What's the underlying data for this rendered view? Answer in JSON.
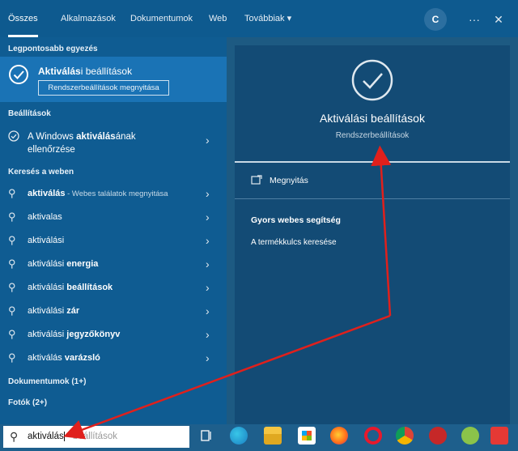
{
  "tabs": [
    {
      "label": "Összes"
    },
    {
      "label": "Alkalmazások"
    },
    {
      "label": "Dokumentumok"
    },
    {
      "label": "Web"
    },
    {
      "label": "Továbbiak ▾"
    }
  ],
  "header": {
    "avatar_letter": "C",
    "more": "···",
    "close": "✕"
  },
  "best_match": {
    "section": "Legpontosabb egyezés",
    "title_bold": "Aktiválás",
    "title_rest": "i beállítások",
    "action": "Rendszerbeállítások megnyitása"
  },
  "settings": {
    "section": "Beállítások",
    "line1_pre": "A Windows ",
    "line1_bold": "aktiválás",
    "line1_post": "ának",
    "line2": "ellenőrzése"
  },
  "web": {
    "section": "Keresés a weben",
    "items": [
      {
        "pre": "aktiválás",
        "bold": "",
        "sub": " - Webes találatok megnyitása"
      },
      {
        "pre": "aktivalas",
        "bold": "",
        "sub": ""
      },
      {
        "pre": "aktiválási",
        "bold": "",
        "sub": ""
      },
      {
        "pre": "aktiválási ",
        "bold": "energia",
        "sub": ""
      },
      {
        "pre": "aktiválási ",
        "bold": "beállítások",
        "sub": ""
      },
      {
        "pre": "aktiválási ",
        "bold": "zár",
        "sub": ""
      },
      {
        "pre": "aktiválási ",
        "bold": "jegyzőkönyv",
        "sub": ""
      },
      {
        "pre": "aktiválás ",
        "bold": "varázsló",
        "sub": ""
      }
    ]
  },
  "documents_section": "Dokumentumok (1+)",
  "photos_section": "Fotók (2+)",
  "detail": {
    "title": "Aktiválási beállítások",
    "subtitle": "Rendszerbeállítások",
    "open_label": "Megnyitás",
    "help_title": "Gyors webes segítség",
    "help_link": "A termékkulcs keresése"
  },
  "search": {
    "typed": "aktiválás",
    "suggestion": "beállítások"
  },
  "taskbar_icons": [
    "task-view-icon",
    "edge-icon",
    "file-explorer-icon",
    "store-icon",
    "firefox-icon",
    "opera-icon",
    "chrome-icon",
    "app-red-icon",
    "app-green-icon",
    "app-red-small-icon"
  ],
  "colors": {
    "accent": "#1a73b5",
    "arrow": "#e0201c"
  }
}
